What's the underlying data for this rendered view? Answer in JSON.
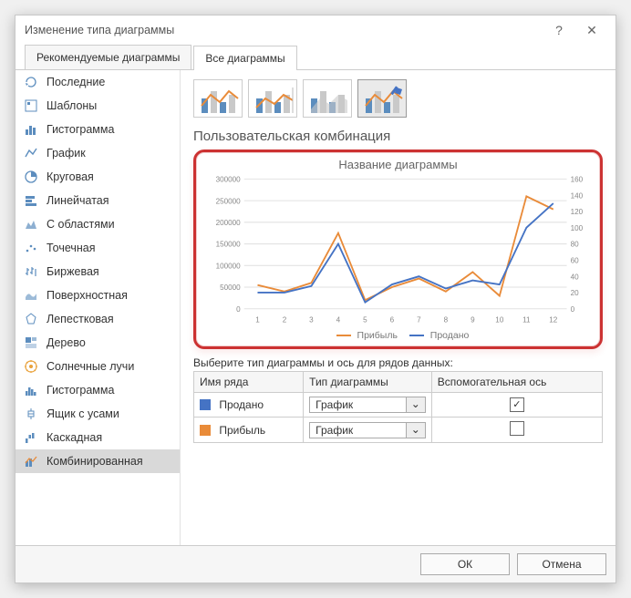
{
  "window": {
    "title": "Изменение типа диаграммы",
    "help": "?",
    "close": "✕"
  },
  "tabs": [
    {
      "label": "Рекомендуемые диаграммы",
      "active": false
    },
    {
      "label": "Все диаграммы",
      "active": true
    }
  ],
  "sidebar": {
    "items": [
      {
        "label": "Последние",
        "icon": "recent-icon"
      },
      {
        "label": "Шаблоны",
        "icon": "templates-icon"
      },
      {
        "label": "Гистограмма",
        "icon": "bar-icon"
      },
      {
        "label": "График",
        "icon": "line-icon"
      },
      {
        "label": "Круговая",
        "icon": "pie-icon"
      },
      {
        "label": "Линейчатая",
        "icon": "hbar-icon"
      },
      {
        "label": "С областями",
        "icon": "area-icon"
      },
      {
        "label": "Точечная",
        "icon": "scatter-icon"
      },
      {
        "label": "Биржевая",
        "icon": "stock-icon"
      },
      {
        "label": "Поверхностная",
        "icon": "surface-icon"
      },
      {
        "label": "Лепестковая",
        "icon": "radar-icon"
      },
      {
        "label": "Дерево",
        "icon": "tree-icon"
      },
      {
        "label": "Солнечные лучи",
        "icon": "sunburst-icon"
      },
      {
        "label": "Гистограмма",
        "icon": "histogram-icon"
      },
      {
        "label": "Ящик с усами",
        "icon": "boxplot-icon"
      },
      {
        "label": "Каскадная",
        "icon": "waterfall-icon"
      },
      {
        "label": "Комбинированная",
        "icon": "combo-icon"
      }
    ],
    "selected_index": 16
  },
  "subtypes": {
    "selected_index": 3,
    "items": [
      "combo-preset-1",
      "combo-preset-2",
      "combo-preset-3",
      "combo-custom"
    ]
  },
  "section_title": "Пользовательская комбинация",
  "chart_title": "Название диаграммы",
  "chart_data": {
    "type": "line",
    "title": "Название диаграммы",
    "x": [
      1,
      2,
      3,
      4,
      5,
      6,
      7,
      8,
      9,
      10,
      11,
      12
    ],
    "series": [
      {
        "name": "Прибыль",
        "axis": "left",
        "color": "#e98b39",
        "values": [
          55000,
          40000,
          60000,
          175000,
          20000,
          50000,
          70000,
          40000,
          85000,
          30000,
          260000,
          230000
        ]
      },
      {
        "name": "Продано",
        "axis": "right",
        "color": "#4573c4",
        "values": [
          20,
          20,
          28,
          80,
          8,
          30,
          40,
          25,
          35,
          30,
          100,
          130
        ]
      }
    ],
    "left_axis": {
      "min": 0,
      "max": 300000,
      "step": 50000,
      "label": ""
    },
    "right_axis": {
      "min": 0,
      "max": 160,
      "step": 20,
      "label": ""
    },
    "xlabel": "",
    "legend_position": "bottom",
    "grid": true
  },
  "legend": {
    "series1": "Прибыль",
    "series2": "Продано"
  },
  "series_prompt": "Выберите тип диаграммы и ось для рядов данных:",
  "series_table": {
    "headers": {
      "name": "Имя ряда",
      "type": "Тип диаграммы",
      "secondary": "Вспомогательная ось"
    },
    "rows": [
      {
        "color": "#4573c4",
        "name": "Продано",
        "type": "График",
        "secondary": true
      },
      {
        "color": "#e98b39",
        "name": "Прибыль",
        "type": "График",
        "secondary": false
      }
    ]
  },
  "footer": {
    "ok": "ОК",
    "cancel": "Отмена"
  },
  "axis_ticks": {
    "left": [
      "0",
      "50000",
      "100000",
      "150000",
      "200000",
      "250000",
      "300000"
    ],
    "right": [
      "0",
      "20",
      "40",
      "60",
      "80",
      "100",
      "120",
      "140",
      "160"
    ]
  }
}
